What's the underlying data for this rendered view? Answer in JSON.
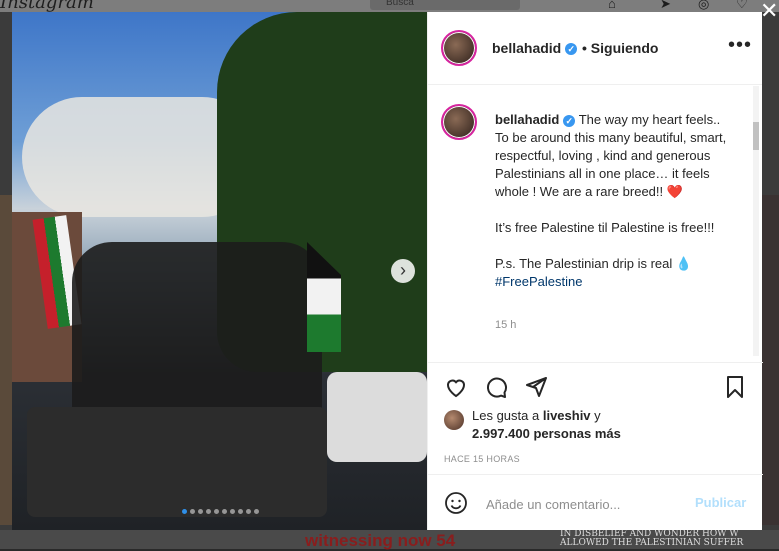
{
  "background": {
    "logo": "Instagram",
    "search_placeholder": "Busca",
    "bottom_headline": "witnessing now 54",
    "bottom_caption": "IN DISBELIEF AND WONDER HOW W ALLOWED THE PALESTINIAN SUFFER"
  },
  "post": {
    "username": "bellahadid",
    "verified": true,
    "follow_status": "• Siguiendo",
    "caption": {
      "p1": "The way my heart feels.. To be around this many beautiful, smart, respectful, loving , kind and generous Palestinians all in one place… it feels whole ! We are a rare breed!!",
      "p1_emoji": "❤️",
      "p2": "It’s free Palestine til Palestine is free!!!",
      "p3": "P.s. The Palestinian drip is real 💧",
      "hashtag": "#FreePalestine"
    },
    "time_ago": "15 h",
    "likes": {
      "prefix": "Les gusta a",
      "user": "liveshiv",
      "connector": "y",
      "count_text": "2.997.400 personas más"
    },
    "date": "HACE 15 HORAS",
    "comment_placeholder": "Añade un comentario...",
    "post_button": "Publicar",
    "carousel": {
      "slides": 10,
      "active_index": 0
    }
  },
  "colors": {
    "accent_blue": "#3897f0",
    "post_button_disabled": "#b2dffc",
    "heart_red": "#e0245e",
    "story_ring": "#d6249f"
  }
}
